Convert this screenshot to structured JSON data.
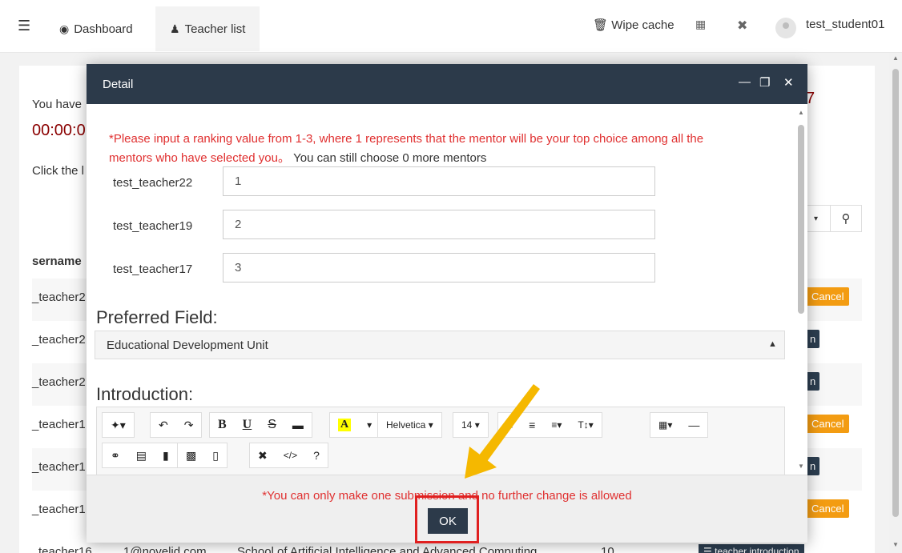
{
  "topbar": {
    "tabs": [
      {
        "icon": "dashboard-icon",
        "label": "Dashboard"
      },
      {
        "icon": "teacher-icon",
        "label": "Teacher list"
      }
    ],
    "wipe_cache": "Wipe cache",
    "username": "test_student01"
  },
  "background": {
    "you_have": "You have",
    "timer": "00:00:0",
    "red_digit": "7",
    "click_the": "Click the l",
    "column_header": "sername",
    "rows": [
      {
        "name": "_teacher2",
        "action": "Cancel"
      },
      {
        "name": "_teacher2",
        "action": "n"
      },
      {
        "name": "_teacher2",
        "action": "n"
      },
      {
        "name": "_teacher1",
        "action": "Cancel"
      },
      {
        "name": "_teacher1",
        "action": "n"
      },
      {
        "name": "_teacher1",
        "action": "Cancel"
      }
    ],
    "bottom_row": {
      "name": "teacher16",
      "email": "1@novelid.com",
      "school": "School of Artificial Intelligence and Advanced Computing",
      "count": "10",
      "button": "teacher introduction"
    }
  },
  "modal": {
    "title": "Detail",
    "notice_red": "*Please input a ranking value from 1-3, where 1 represents that the mentor will be your top choice among all the mentors who have selected you。",
    "notice_tail": "You can still choose 0 more mentors",
    "rankings": [
      {
        "teacher": "test_teacher22",
        "value": "1"
      },
      {
        "teacher": "test_teacher19",
        "value": "2"
      },
      {
        "teacher": "test_teacher17",
        "value": "3"
      }
    ],
    "preferred_field_label": "Preferred Field:",
    "preferred_field_value": "Educational Development Unit",
    "introduction_label": "Introduction:",
    "editor_font": "Helvetica",
    "editor_size": "14",
    "footer_note": "*You can only make one submission and no further change is allowed",
    "ok_label": "OK"
  },
  "colors": {
    "header_dark": "#2c3a4a",
    "warning_red": "#e03030",
    "cancel_orange": "#f39c12",
    "highlight_red": "#e02020",
    "arrow_yellow": "#f5b800"
  }
}
